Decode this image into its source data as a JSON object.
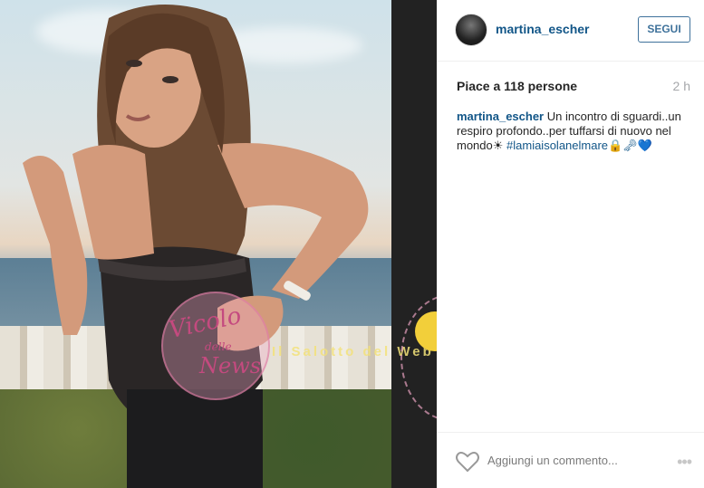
{
  "post": {
    "username": "martina_escher",
    "follow_label": "SEGUI",
    "likes_text": "Piace a 118 persone",
    "time_ago": "2 h",
    "caption_user": "martina_escher",
    "caption_text": " Un incontro di sguardi..un respiro profondo..per tuffarsi di nuovo nel mondo☀ ",
    "caption_hashtag": "#lamiaisolanelmare🔒🗝💙",
    "comment_placeholder": "Aggiungi un commento...",
    "more_label": "•••"
  },
  "watermark": {
    "line1": "Vicolo",
    "line2": "delle",
    "line3": "News",
    "banner": "Il Salotto del Web"
  },
  "colors": {
    "link": "#125688",
    "button_border": "#3f729b",
    "muted": "#a5a7aa",
    "separator": "#222222"
  }
}
